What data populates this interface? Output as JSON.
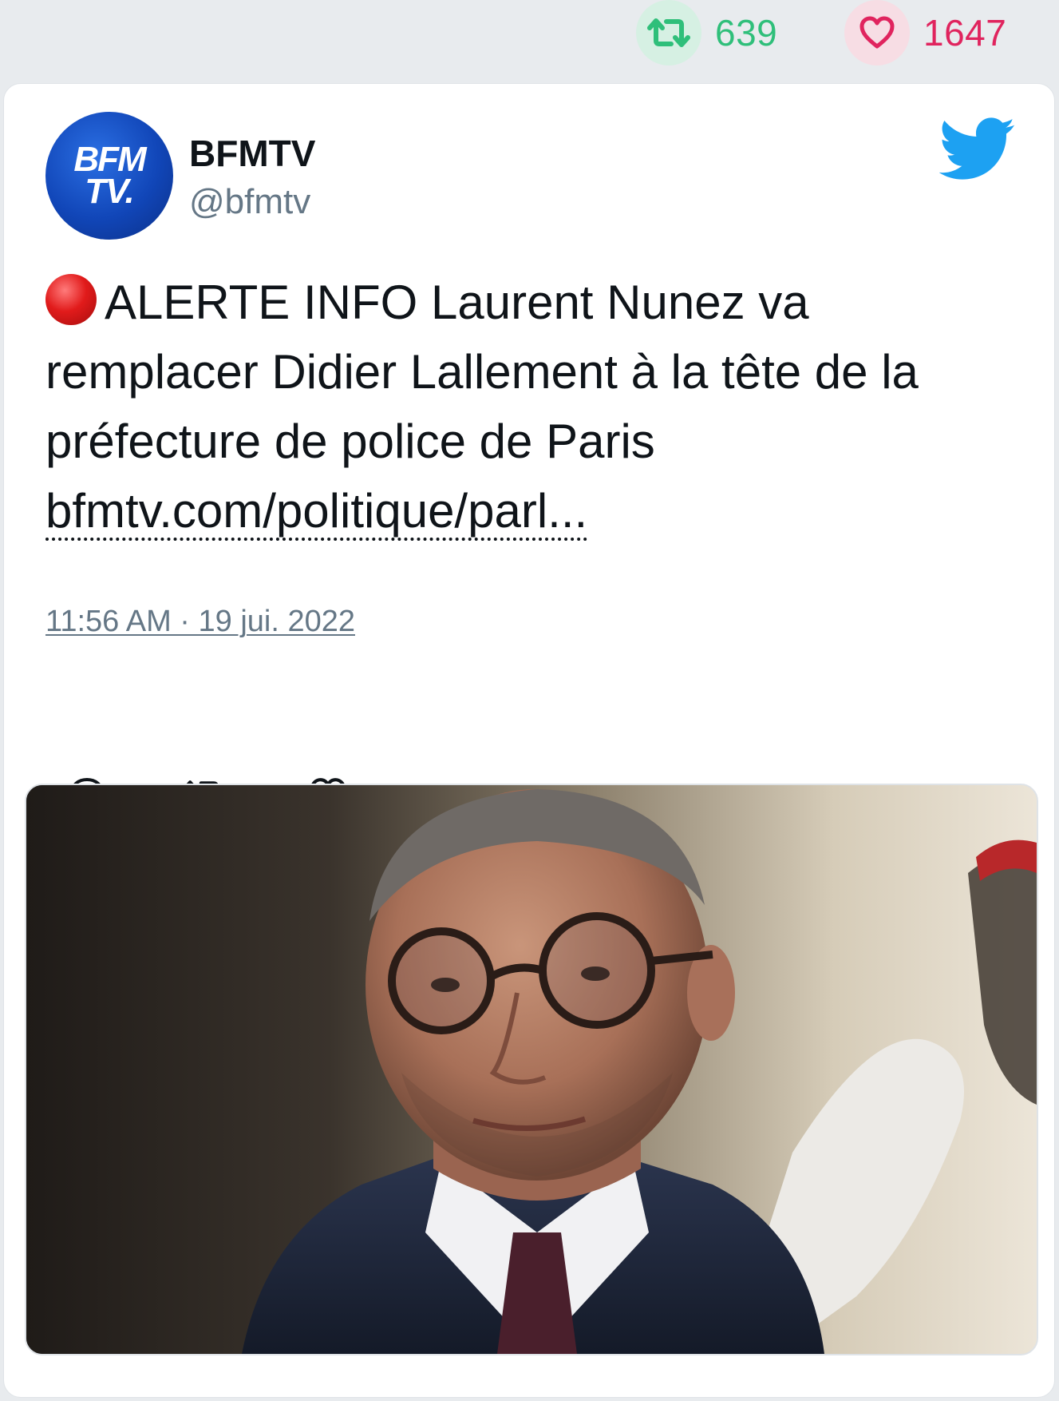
{
  "stats": {
    "retweets": "639",
    "likes": "1647",
    "retweet_color": "#2fbf7a",
    "like_color": "#e0245e"
  },
  "author": {
    "name": "BFMTV",
    "handle": "@bfmtv",
    "avatar_line1": "BFM",
    "avatar_line2": "TV."
  },
  "tweet": {
    "emoji": "red-circle",
    "text": "ALERTE INFO Laurent Nunez va remplacer Didier Lallement à la tête de la préfecture de police de Paris",
    "link": "bfmtv.com/politique/parl...",
    "timestamp": "11:56 AM · 19 jui. 2022"
  },
  "icons": {
    "brand": "twitter-bird-icon",
    "reply": "reply-icon",
    "retweet": "retweet-icon",
    "like": "heart-icon"
  },
  "colors": {
    "twitter_blue": "#1da1f2",
    "text": "#0f1419",
    "muted": "#657786"
  }
}
